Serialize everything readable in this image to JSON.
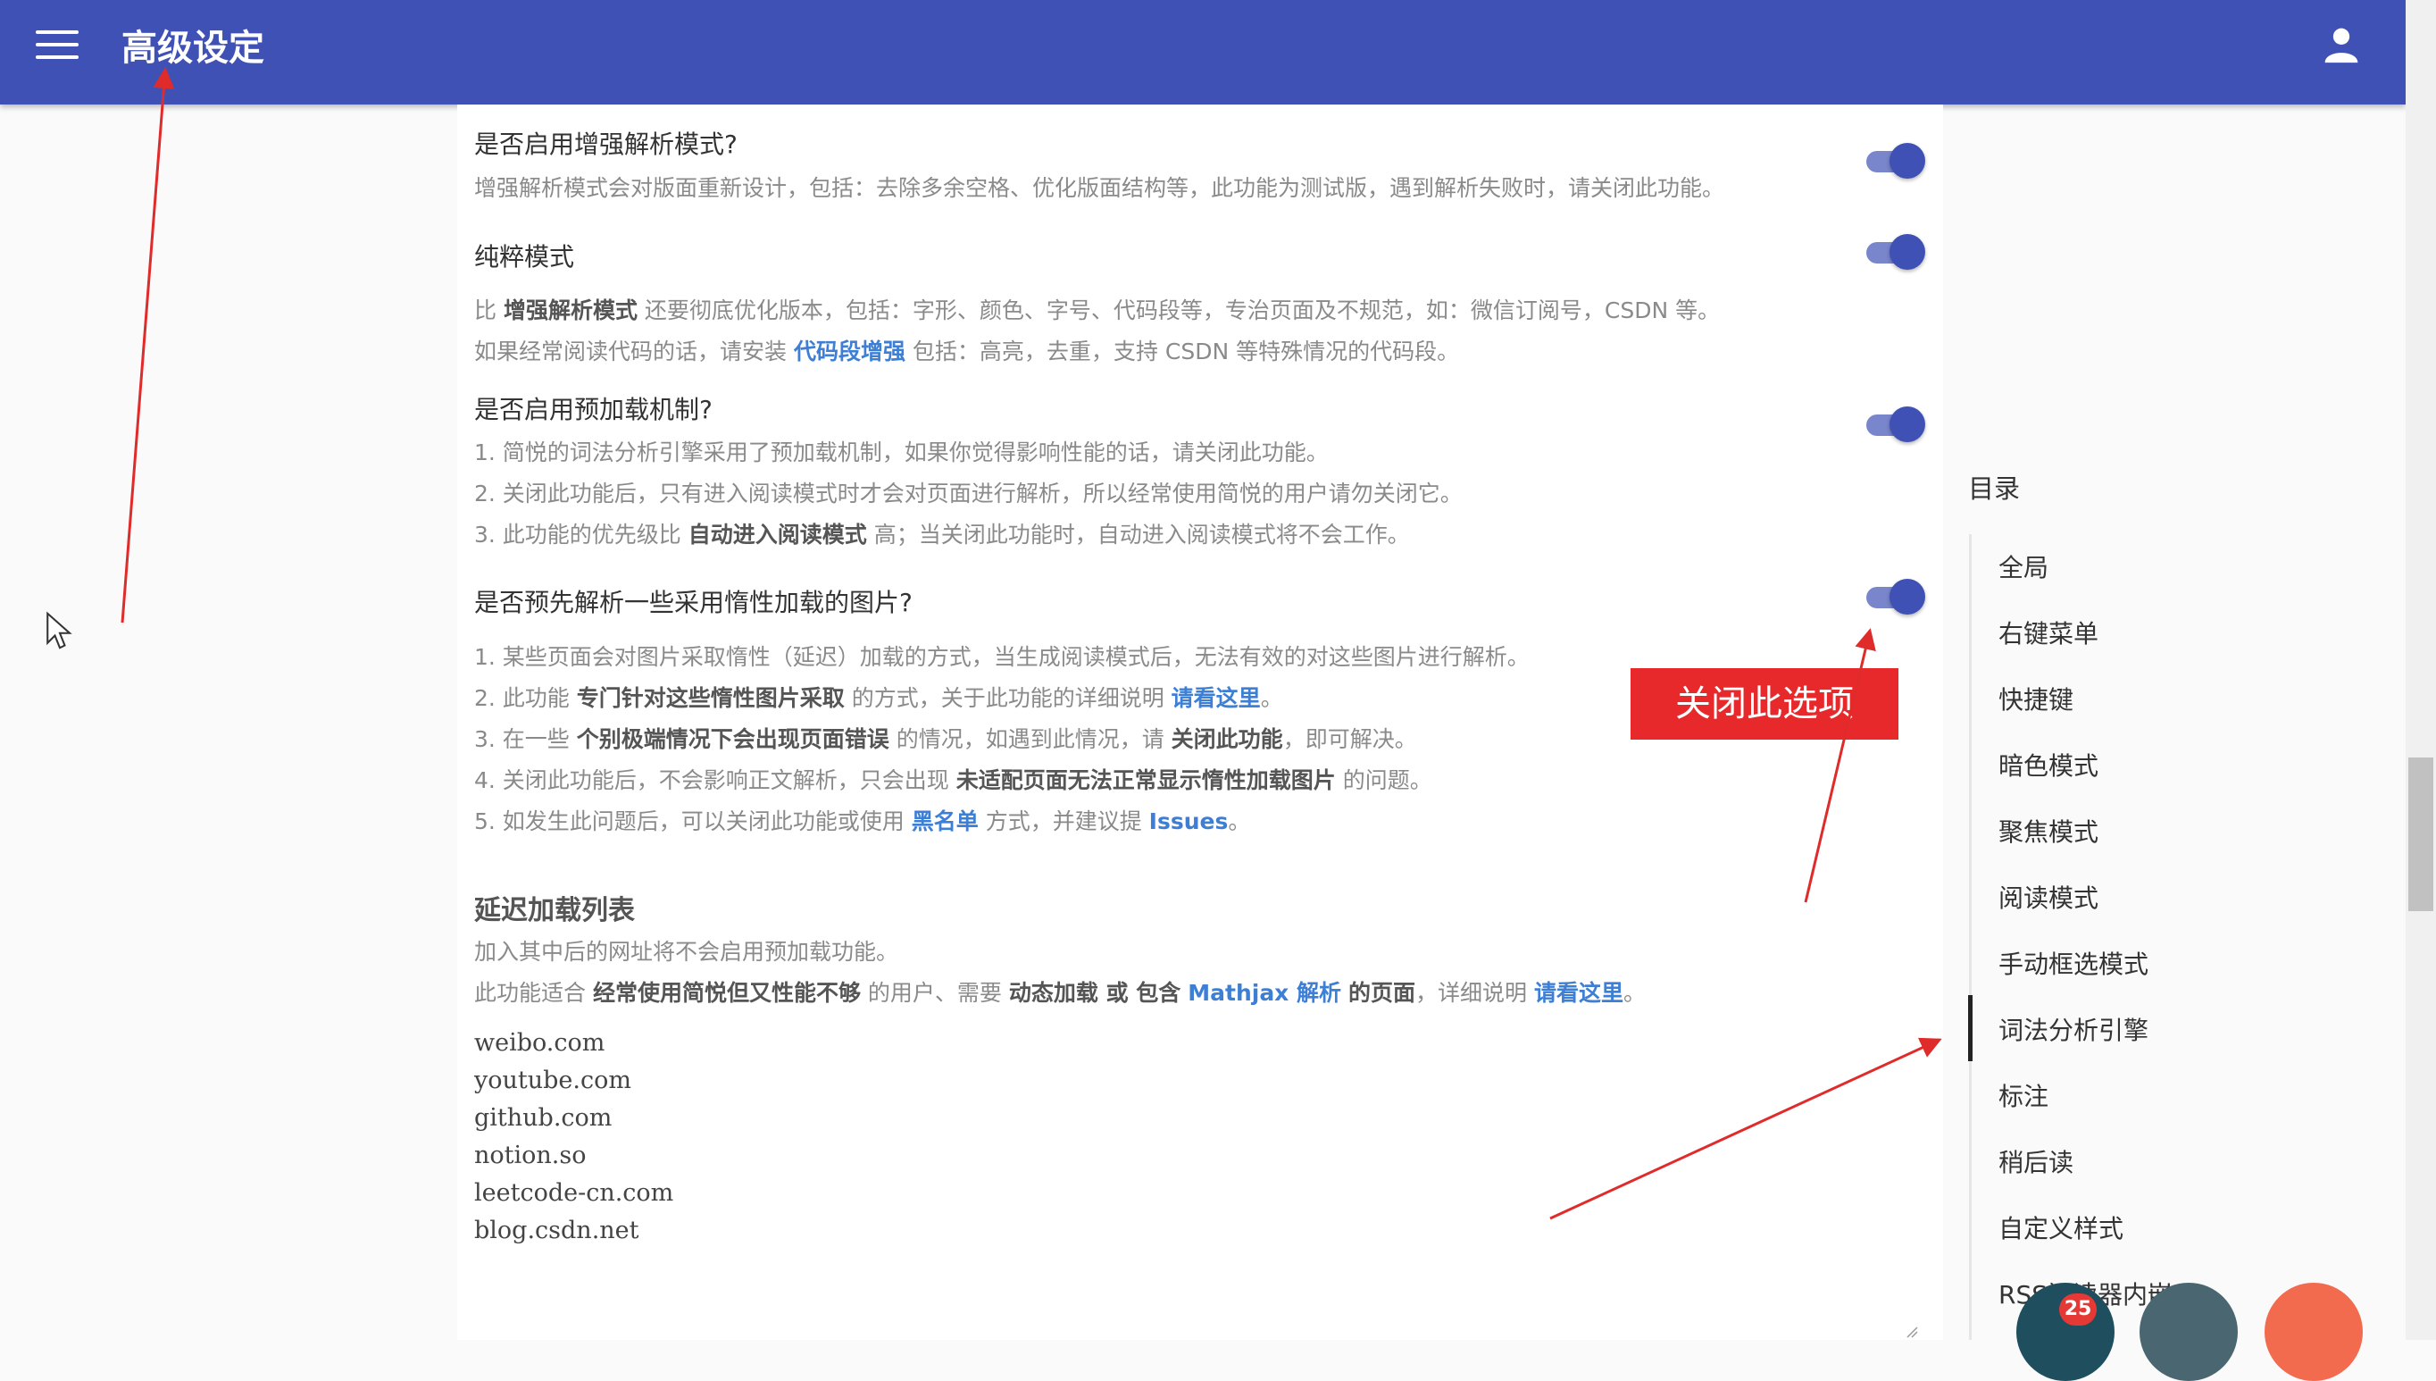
{
  "header": {
    "title": "高级设定"
  },
  "settings": [
    {
      "title": "是否启用增强解析模式?",
      "enabled": true,
      "lines": [
        [
          {
            "t": "增强解析模式会对版面重新设计，包括：去除多余空格、优化版面结构等，此功能为测试版，遇到解析失败时，请关闭此功能。"
          }
        ]
      ]
    },
    {
      "title": "纯粹模式",
      "enabled": true,
      "lines": [
        [
          {
            "t": "比 "
          },
          {
            "b": "增强解析模式"
          },
          {
            "t": " 还要彻底优化版本，包括：字形、颜色、字号、代码段等，专治页面及不规范，如：微信订阅号，CSDN 等。"
          }
        ],
        [
          {
            "t": "如果经常阅读代码的话，请安装 "
          },
          {
            "a": "代码段增强"
          },
          {
            "t": " 包括：高亮，去重，支持 CSDN 等特殊情况的代码段。"
          }
        ]
      ]
    },
    {
      "title": "是否启用预加载机制?",
      "enabled": true,
      "lines": [
        [
          {
            "t": "1. 简悦的词法分析引擎采用了预加载机制，如果你觉得影响性能的话，请关闭此功能。"
          }
        ],
        [
          {
            "t": "2. 关闭此功能后，只有进入阅读模式时才会对页面进行解析，所以经常使用简悦的用户请勿关闭它。"
          }
        ],
        [
          {
            "t": "3. 此功能的优先级比 "
          },
          {
            "b": "自动进入阅读模式"
          },
          {
            "t": " 高；当关闭此功能时，自动进入阅读模式将不会工作。"
          }
        ]
      ]
    },
    {
      "title": "是否预先解析一些采用惰性加载的图片?",
      "enabled": true,
      "lines": [
        [
          {
            "t": "1. 某些页面会对图片采取惰性（延迟）加载的方式，当生成阅读模式后，无法有效的对这些图片进行解析。"
          }
        ],
        [
          {
            "t": "2. 此功能 "
          },
          {
            "b": "专门针对这些惰性图片采取"
          },
          {
            "t": " 的方式，关于此功能的详细说明 "
          },
          {
            "a": "请看这里"
          },
          {
            "t": "。"
          }
        ],
        [
          {
            "t": "3. 在一些 "
          },
          {
            "b": "个别极端情况下会出现页面错误"
          },
          {
            "t": " 的情况，如遇到此情况，请 "
          },
          {
            "b": "关闭此功能"
          },
          {
            "t": "，即可解决。"
          }
        ],
        [
          {
            "t": "4. 关闭此功能后，不会影响正文解析，只会出现 "
          },
          {
            "b": "未适配页面无法正常显示惰性加载图片"
          },
          {
            "t": " 的问题。"
          }
        ],
        [
          {
            "t": "5. 如发生此问题后，可以关闭此功能或使用 "
          },
          {
            "a": "黑名单"
          },
          {
            "t": " 方式，并建议提 "
          },
          {
            "a": "Issues"
          },
          {
            "t": "。"
          }
        ]
      ]
    }
  ],
  "delay_section": {
    "heading": "延迟加载列表",
    "lines": [
      [
        {
          "t": "加入其中后的网址将不会启用预加载功能。"
        }
      ],
      [
        {
          "t": "此功能适合 "
        },
        {
          "b": "经常使用简悦但又性能不够"
        },
        {
          "t": " 的用户、需要 "
        },
        {
          "b": "动态加载 或 包含"
        },
        {
          "t": " "
        },
        {
          "a": "Mathjax 解析"
        },
        {
          "t": " "
        },
        {
          "b": "的页面"
        },
        {
          "t": "，详细说明 "
        },
        {
          "a": "请看这里"
        },
        {
          "t": "。"
        }
      ]
    ],
    "sites": [
      "weibo.com",
      "youtube.com",
      "github.com",
      "notion.so",
      "leetcode-cn.com",
      "blog.csdn.net"
    ]
  },
  "toc": {
    "title": "目录",
    "items": [
      "全局",
      "右键菜单",
      "快捷键",
      "暗色模式",
      "聚焦模式",
      "阅读模式",
      "手动框选模式",
      "词法分析引擎",
      "标注",
      "稍后读",
      "自定义样式",
      "RSS阅读器内嵌"
    ],
    "active": "词法分析引擎"
  },
  "annotation": {
    "callout": "关闭此选项",
    "color": "#e8292c"
  },
  "fab": {
    "badge_count": "25"
  },
  "colors": {
    "appbar": "#3f51b5",
    "link": "#3e7fd6",
    "toggle_on": "#3f51b5"
  }
}
